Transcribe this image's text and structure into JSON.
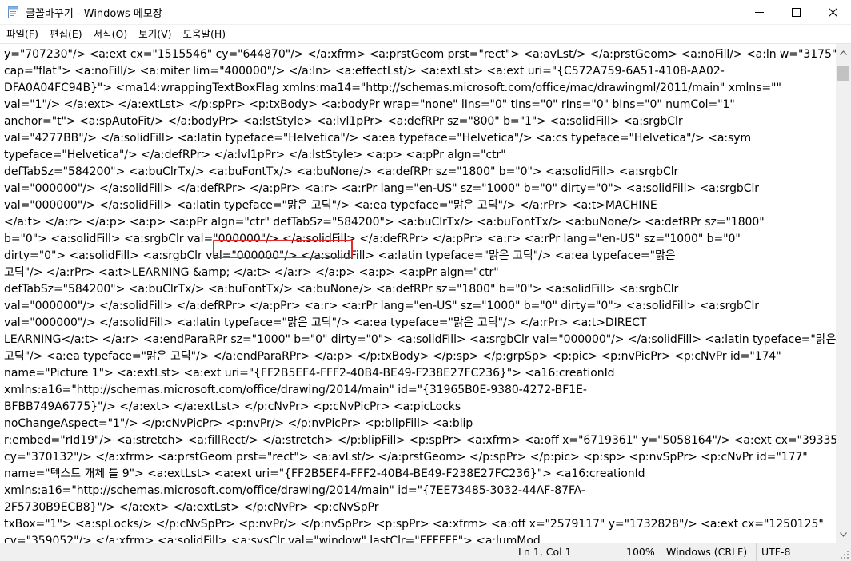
{
  "window": {
    "title": "글꼴바꾸기 - Windows 메모장",
    "icon": "notepad-icon",
    "controls": [
      "minimize-icon",
      "maximize-icon",
      "close-icon"
    ]
  },
  "menu": [
    "파일(F)",
    "편집(E)",
    "서식(O)",
    "보기(V)",
    "도움말(H)"
  ],
  "editor": {
    "lines": [
      "y=\"707230\"/> <a:ext cx=\"1515546\" cy=\"644870\"/> </a:xfrm> <a:prstGeom prst=\"rect\"> <a:avLst/> </a:prstGeom> <a:noFill/> <a:ln w=\"3175\"",
      "cap=\"flat\"> <a:noFill/> <a:miter lim=\"400000\"/> </a:ln> <a:effectLst/> <a:extLst> <a:ext uri=\"{C572A759-6A51-4108-AA02-",
      "DFA0A04FC94B}\"> <ma14:wrappingTextBoxFlag xmlns:ma14=\"http://schemas.microsoft.com/office/mac/drawingml/2011/main\" xmlns=\"\"",
      "val=\"1\"/> </a:ext> </a:extLst> </p:spPr> <p:txBody> <a:bodyPr wrap=\"none\" lIns=\"0\" tIns=\"0\" rIns=\"0\" bIns=\"0\" numCol=\"1\"",
      "anchor=\"t\"> <a:spAutoFit/> </a:bodyPr> <a:lstStyle> <a:lvl1pPr> <a:defRPr sz=\"800\" b=\"1\"> <a:solidFill> <a:srgbClr",
      "val=\"4277BB\"/> </a:solidFill> <a:latin typeface=\"Helvetica\"/> <a:ea typeface=\"Helvetica\"/> <a:cs typeface=\"Helvetica\"/> <a:sym",
      "typeface=\"Helvetica\"/> </a:defRPr> </a:lvl1pPr> </a:lstStyle> <a:p> <a:pPr algn=\"ctr\"",
      "defTabSz=\"584200\"> <a:buClrTx/> <a:buFontTx/> <a:buNone/> <a:defRPr sz=\"1800\" b=\"0\"> <a:solidFill> <a:srgbClr",
      "val=\"000000\"/> </a:solidFill> </a:defRPr> </a:pPr> <a:r> <a:rPr lang=\"en-US\" sz=\"1000\" b=\"0\" dirty=\"0\"> <a:solidFill> <a:srgbClr",
      "val=\"000000\"/> </a:solidFill> <a:latin typeface=\"맑은 고딕\"/> <a:ea typeface=\"맑은 고딕\"/> </a:rPr> <a:t>MACHINE",
      "</a:t> </a:r> </a:p> <a:p> <a:pPr algn=\"ctr\" defTabSz=\"584200\"> <a:buClrTx/> <a:buFontTx/> <a:buNone/> <a:defRPr sz=\"1800\"",
      "b=\"0\"> <a:solidFill> <a:srgbClr val=\"000000\"/> </a:solidFill> </a:defRPr> </a:pPr> <a:r> <a:rPr lang=\"en-US\" sz=\"1000\" b=\"0\"",
      "dirty=\"0\"> <a:solidFill> <a:srgbClr val=\"000000\"/> </a:solidFill> <a:latin typeface=\"맑은 고딕\"/> <a:ea typeface=\"맑은",
      "고딕\"/> </a:rPr> <a:t>LEARNING &amp; </a:t> </a:r> </a:p> <a:p> <a:pPr algn=\"ctr\"",
      "defTabSz=\"584200\"> <a:buClrTx/> <a:buFontTx/> <a:buNone/> <a:defRPr sz=\"1800\" b=\"0\"> <a:solidFill> <a:srgbClr",
      "val=\"000000\"/> </a:solidFill> </a:defRPr> </a:pPr> <a:r> <a:rPr lang=\"en-US\" sz=\"1000\" b=\"0\" dirty=\"0\"> <a:solidFill> <a:srgbClr",
      "val=\"000000\"/> </a:solidFill> <a:latin typeface=\"맑은 고딕\"/> <a:ea typeface=\"맑은 고딕\"/> </a:rPr> <a:t>DIRECT",
      "LEARNING</a:t> </a:r> <a:endParaRPr sz=\"1000\" b=\"0\" dirty=\"0\"> <a:solidFill> <a:srgbClr val=\"000000\"/> </a:solidFill> <a:latin typeface=\"맑은",
      "고딕\"/> <a:ea typeface=\"맑은 고딕\"/> </a:endParaRPr> </a:p> </p:txBody> </p:sp> </p:grpSp> <p:pic> <p:nvPicPr> <p:cNvPr id=\"174\"",
      "name=\"Picture 1\"> <a:extLst> <a:ext uri=\"{FF2B5EF4-FFF2-40B4-BE49-F238E27FC236}\"> <a16:creationId",
      "xmlns:a16=\"http://schemas.microsoft.com/office/drawing/2014/main\" id=\"{31965B0E-9380-4272-BF1E-",
      "BFBB749A6775}\"/> </a:ext> </a:extLst> </p:cNvPr> <p:cNvPicPr> <a:picLocks",
      "noChangeAspect=\"1\"/> </p:cNvPicPr> <p:nvPr/> </p:nvPicPr> <p:blipFill> <a:blip",
      "r:embed=\"rId19\"/> <a:stretch> <a:fillRect/> </a:stretch> </p:blipFill> <p:spPr> <a:xfrm> <a:off x=\"6719361\" y=\"5058164\"/> <a:ext cx=\"393357\"",
      "cy=\"370132\"/> </a:xfrm> <a:prstGeom prst=\"rect\"> <a:avLst/> </a:prstGeom> </p:spPr> </p:pic> <p:sp> <p:nvSpPr> <p:cNvPr id=\"177\"",
      "name=\"텍스트 개체 틀 9\"> <a:extLst> <a:ext uri=\"{FF2B5EF4-FFF2-40B4-BE49-F238E27FC236}\"> <a16:creationId",
      "xmlns:a16=\"http://schemas.microsoft.com/office/drawing/2014/main\" id=\"{7EE73485-3032-44AF-87FA-",
      "2F5730B9ECB8}\"/> </a:ext> </a:extLst> </p:cNvPr> <p:cNvSpPr",
      "txBox=\"1\"> <a:spLocks/> </p:cNvSpPr> <p:nvPr/> </p:nvSpPr> <p:spPr> <a:xfrm> <a:off x=\"2579117\" y=\"1732828\"/> <a:ext cx=\"1250125\"",
      "cy=\"359052\"/> </a:xfrm> <a:solidFill> <a:sysClr val=\"window\" lastClr=\"FFFFFF\"> <a:lumMod"
    ]
  },
  "statusbar": {
    "position": "Ln 1, Col 1",
    "zoom": "100%",
    "line_ending": "Windows (CRLF)",
    "encoding": "UTF-8"
  },
  "colors": {
    "highlight_border": "#e32b2b"
  }
}
